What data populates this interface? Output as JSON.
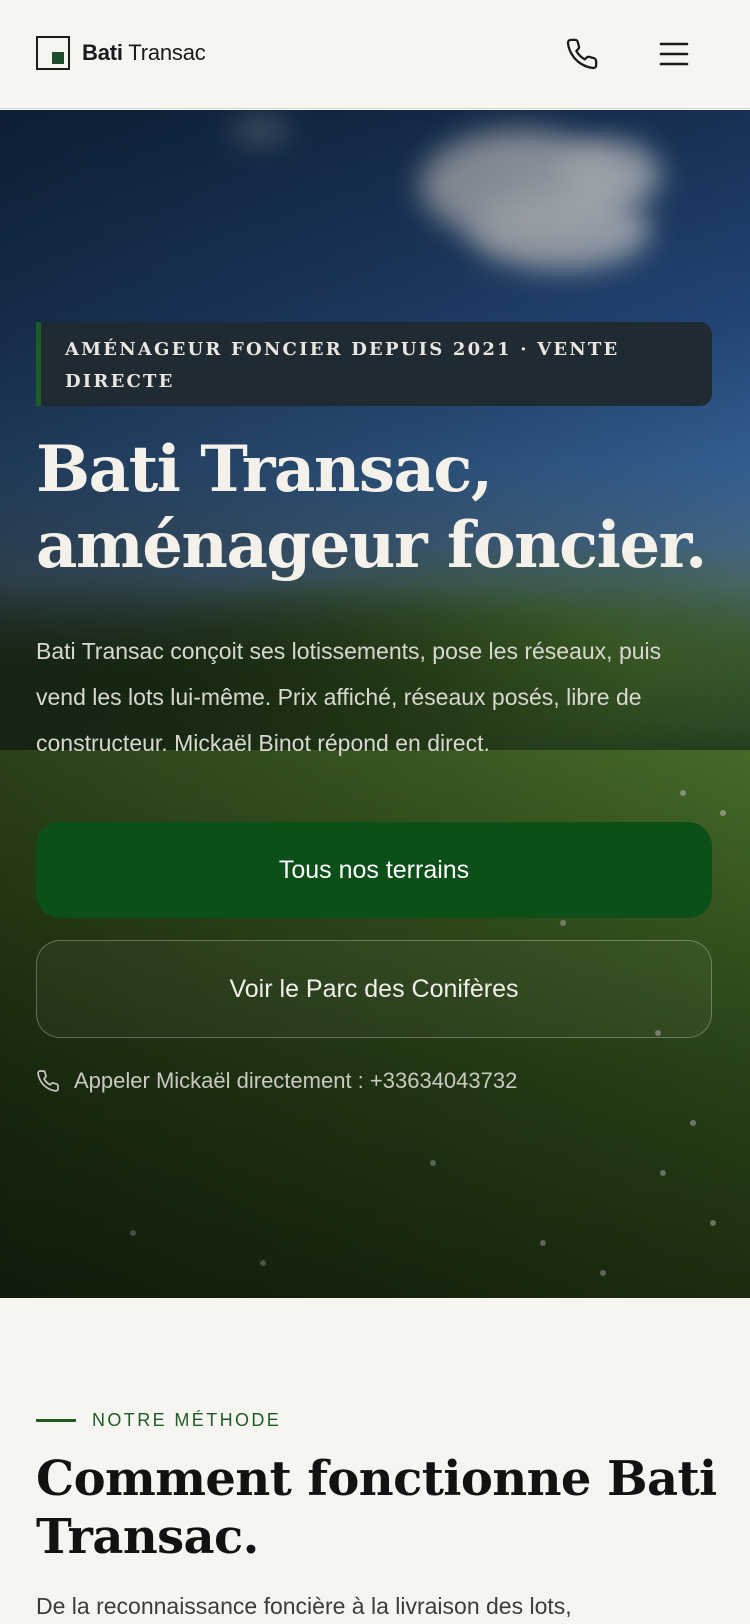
{
  "header": {
    "brand_bold": "Bati",
    "brand_rest": "Transac",
    "icons": [
      "phone-icon",
      "menu-icon"
    ]
  },
  "hero": {
    "badge": "AMÉNAGEUR FONCIER DEPUIS 2021 · VENTE DIRECTE",
    "title": "Bati Transac, aménageur foncier.",
    "description": "Bati Transac conçoit ses lotissements, pose les réseaux, puis vend les lots lui-même. Prix affiché, réseaux posés, libre de constructeur. Mickaël Binot répond en direct.",
    "primary_cta": "Tous nos terrains",
    "secondary_cta": "Voir le Parc des Conifères",
    "call_text": "Appeler Mickaël directement : +33634043732"
  },
  "method": {
    "eyebrow": "NOTRE MÉTHODE",
    "title": "Comment fonctionne Bati Transac.",
    "description": "De la reconnaissance foncière à la livraison des lots,"
  },
  "colors": {
    "accent_green": "#0d4f18",
    "badge_bg": "#1f2a33",
    "page_bg": "#f7f5f1"
  }
}
